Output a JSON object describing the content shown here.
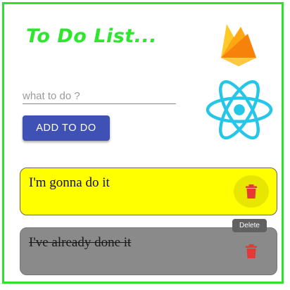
{
  "header": {
    "title": "To Do List..."
  },
  "logos": {
    "firebase": "firebase-icon",
    "react": "react-icon"
  },
  "input": {
    "placeholder": "what to do ?",
    "value": ""
  },
  "add_button": {
    "label": "ADD TO DO"
  },
  "todos": [
    {
      "text": "I'm gonna do it",
      "completed": false,
      "delete_icon": "trash-icon"
    },
    {
      "text": "I've already done it",
      "completed": true,
      "delete_icon": "trash-icon"
    }
  ],
  "tooltip": {
    "text": "Delete"
  },
  "colors": {
    "frame": "#2fe02f",
    "title": "#2ee62e",
    "button": "#3f51b5",
    "active_item": "#ffff00",
    "done_item": "#8a8a8a",
    "trash": "#e53935",
    "react": "#26c6e8"
  }
}
